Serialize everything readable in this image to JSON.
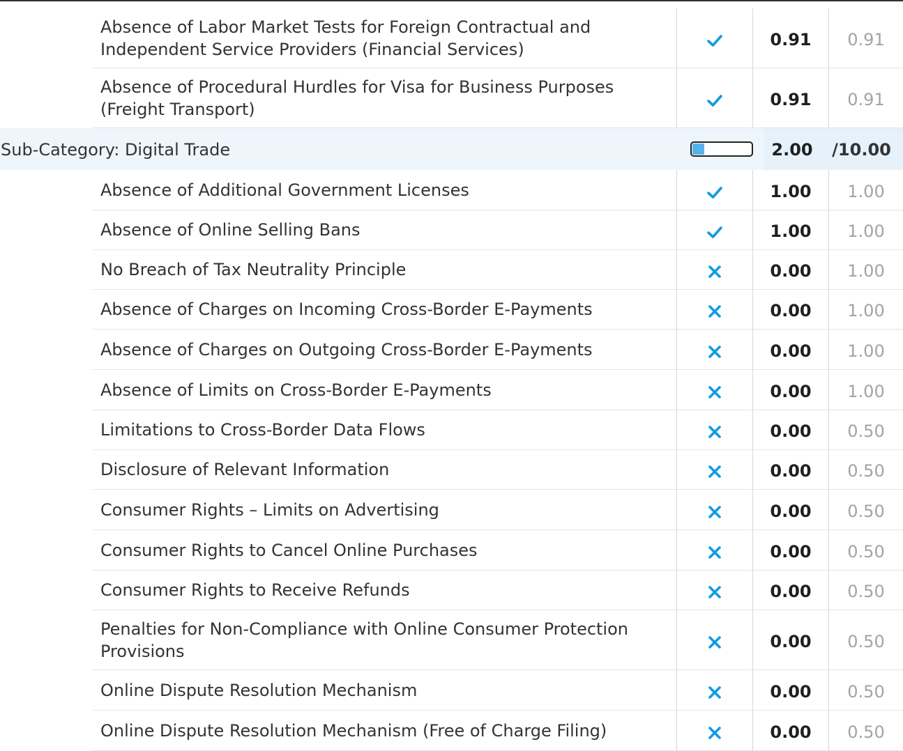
{
  "rows_before": [
    {
      "label": "Absence of Labor Market Tests for Foreign Contractual and Independent Service Providers (Financial Services)",
      "status": "check",
      "score": "0.91",
      "max": "0.91"
    },
    {
      "label": "Absence of Procedural Hurdles for Visa for Business Purposes (Freight Transport)",
      "status": "check",
      "score": "0.91",
      "max": "0.91"
    }
  ],
  "subcategory": {
    "label": "Sub-Category: Digital Trade",
    "score": "2.00",
    "total": "/10.00",
    "progress": 0.2,
    "progress_color": "#55b3ea"
  },
  "rows_after": [
    {
      "label": "Absence of Additional Government Licenses",
      "status": "check",
      "score": "1.00",
      "max": "1.00"
    },
    {
      "label": "Absence of Online Selling Bans",
      "status": "check",
      "score": "1.00",
      "max": "1.00"
    },
    {
      "label": "No Breach of Tax Neutrality Principle",
      "status": "cross",
      "score": "0.00",
      "max": "1.00"
    },
    {
      "label": "Absence of Charges on Incoming Cross-Border E-Payments",
      "status": "cross",
      "score": "0.00",
      "max": "1.00"
    },
    {
      "label": "Absence of Charges on Outgoing Cross-Border E-Payments",
      "status": "cross",
      "score": "0.00",
      "max": "1.00"
    },
    {
      "label": "Absence of Limits on Cross-Border E-Payments",
      "status": "cross",
      "score": "0.00",
      "max": "1.00"
    },
    {
      "label": "Limitations to Cross-Border Data Flows",
      "status": "cross",
      "score": "0.00",
      "max": "0.50"
    },
    {
      "label": "Disclosure of Relevant Information",
      "status": "cross",
      "score": "0.00",
      "max": "0.50"
    },
    {
      "label": "Consumer Rights – Limits on Advertising",
      "status": "cross",
      "score": "0.00",
      "max": "0.50"
    },
    {
      "label": "Consumer Rights to Cancel Online Purchases",
      "status": "cross",
      "score": "0.00",
      "max": "0.50"
    },
    {
      "label": "Consumer Rights to Receive Refunds",
      "status": "cross",
      "score": "0.00",
      "max": "0.50"
    },
    {
      "label": "Penalties for Non-Compliance with Online Consumer Protection Provisions",
      "status": "cross",
      "score": "0.00",
      "max": "0.50"
    },
    {
      "label": "Online Dispute Resolution Mechanism",
      "status": "cross",
      "score": "0.00",
      "max": "0.50"
    },
    {
      "label": "Online Dispute Resolution Mechanism (Free of Charge Filing)",
      "status": "cross",
      "score": "0.00",
      "max": "0.50"
    }
  ],
  "colors": {
    "check": "#0f9ce0",
    "cross": "#0f9ce0"
  },
  "icons": {
    "check": "check-icon",
    "cross": "cross-icon"
  }
}
